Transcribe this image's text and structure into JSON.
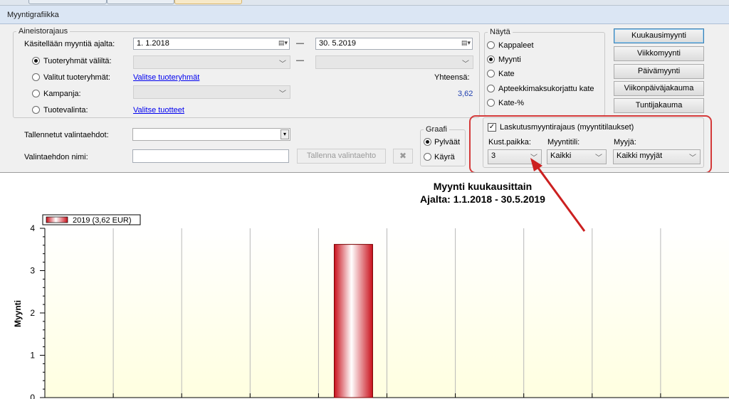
{
  "window": {
    "title": "Myyntigrafiikka"
  },
  "aineisto": {
    "legend": "Aineistorajaus",
    "kasitelty_label": "Käsitellään myyntiä ajalta:",
    "date_from": "1. 1.2018",
    "date_to": "30. 5.2019",
    "dash": "—",
    "dash2": "—",
    "options": [
      {
        "label": "Tuoteryhmät väliltä:",
        "selected": true
      },
      {
        "label": "Valitut tuoteryhmät:",
        "selected": false
      },
      {
        "label": "Kampanja:",
        "selected": false
      },
      {
        "label": "Tuotevalinta:",
        "selected": false
      }
    ],
    "link_tuoteryhmat": "Valitse tuoteryhmät",
    "link_tuotteet": "Valitse tuotteet",
    "yhteensa_label": "Yhteensä:",
    "yhteensa_value": "3,62"
  },
  "tallennetut": {
    "label": "Tallennetut valintaehdot:",
    "nimi_label": "Valintaehdon nimi:",
    "save_button": "Tallenna valintaehto",
    "delete_icon": "✖"
  },
  "graafi": {
    "legend": "Graafi",
    "options": [
      {
        "label": "Pylväät",
        "selected": true
      },
      {
        "label": "Käyrä",
        "selected": false
      }
    ]
  },
  "nayta": {
    "legend": "Näytä",
    "options": [
      {
        "label": "Kappaleet",
        "selected": false
      },
      {
        "label": "Myynti",
        "selected": true
      },
      {
        "label": "Kate",
        "selected": false
      },
      {
        "label": "Apteekkimaksukorjattu kate",
        "selected": false
      },
      {
        "label": "Kate-%",
        "selected": false
      }
    ]
  },
  "buttons": {
    "kuukausi": "Kuukausimyynti",
    "viikko": "Viikkomyynti",
    "paiva": "Päivämyynti",
    "viikonpaiva": "Viikonpäiväjakauma",
    "tunti": "Tuntijakauma"
  },
  "laskutus": {
    "label": "Laskutusmyyntirajaus (myyntitilaukset)",
    "checked": true,
    "kust_label": "Kust.paikka:",
    "kust_value": "3",
    "tili_label": "Myyntitili:",
    "tili_value": "Kaikki",
    "myyja_label": "Myyjä:",
    "myyja_value": "Kaikki myyjät"
  },
  "chart_data": {
    "type": "bar",
    "title": "Myynti kuukausittain",
    "subtitle": "Ajalta: 1.1.2018 - 30.5.2019",
    "ylabel": "Myynti",
    "xlabel": "",
    "ylim": [
      0,
      4
    ],
    "yticks": [
      "0",
      "1",
      "2",
      "3",
      "4"
    ],
    "legend_position": "top-left",
    "series": [
      {
        "name": "2019 (3,62 EUR)",
        "color": "#e8232e"
      }
    ],
    "bar_value": 3.62,
    "bar_slot": 5,
    "slots_visible": 10,
    "grid": true,
    "background_gradient": [
      "#ffffff",
      "#ffffe0"
    ]
  }
}
